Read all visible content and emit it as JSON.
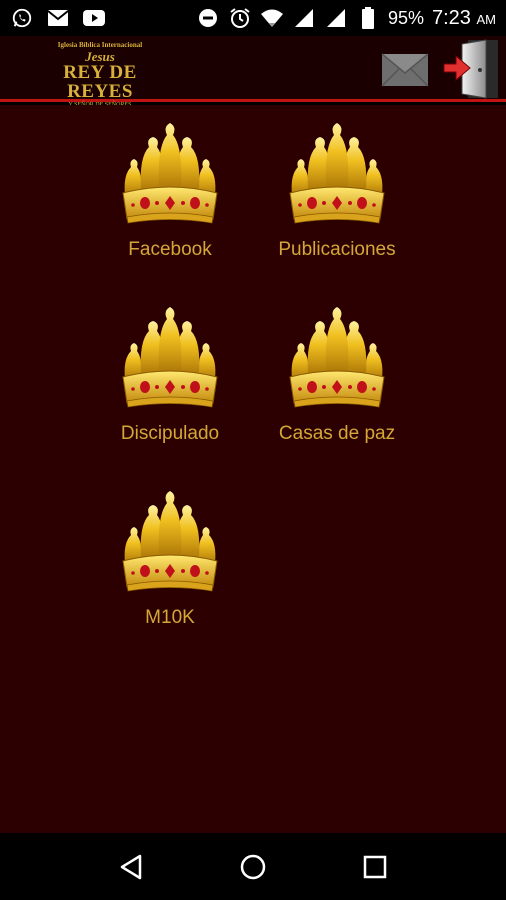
{
  "status_bar": {
    "icons_left": [
      "whatsapp-icon",
      "gmail-icon",
      "youtube-icon"
    ],
    "icons_right": [
      "do-not-disturb-icon",
      "alarm-icon",
      "wifi-icon",
      "signal-icon",
      "signal-icon",
      "battery-icon"
    ],
    "battery": "95%",
    "time": "7:23",
    "ampm": "AM"
  },
  "header": {
    "logo": {
      "line1": "Iglesia Bíblica Internacional",
      "line2": "Jesus",
      "line3": "REY DE REYES",
      "line4": "Y SEÑOR DE SEÑORES"
    },
    "mail_icon": "envelope-icon",
    "exit_icon": "exit-door-icon"
  },
  "tiles": [
    {
      "label": "Facebook",
      "icon": "crown-icon"
    },
    {
      "label": "Publicaciones",
      "icon": "crown-icon"
    },
    {
      "label": "Discipulado",
      "icon": "crown-icon"
    },
    {
      "label": "Casas de paz",
      "icon": "crown-icon"
    },
    {
      "label": "M10K",
      "icon": "crown-icon"
    }
  ],
  "colors": {
    "background": "#2c0000",
    "header": "#1a0000",
    "accent_line": "#c01414",
    "gold": "#d4a737"
  }
}
